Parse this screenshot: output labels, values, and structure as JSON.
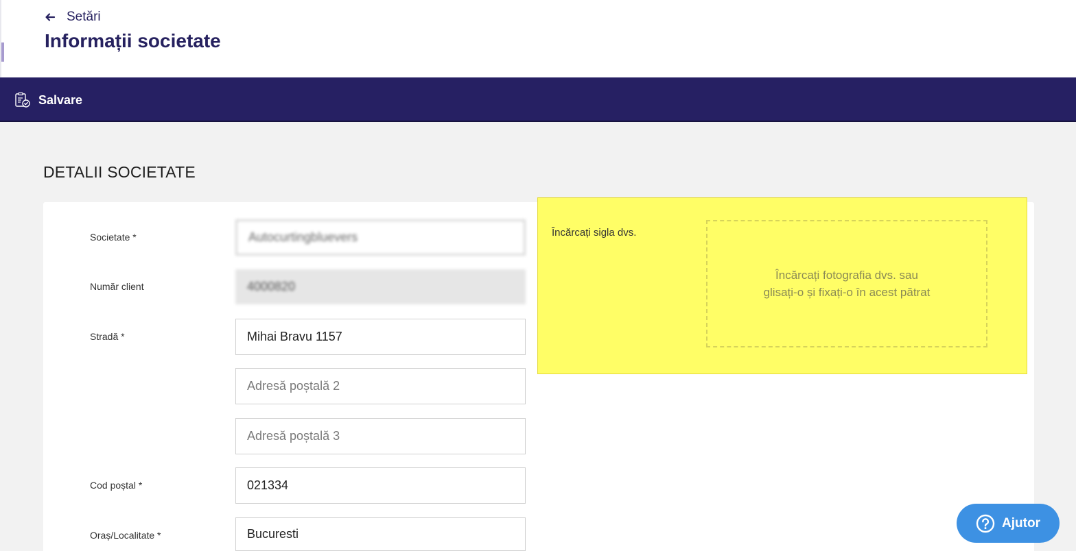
{
  "header": {
    "back_label": "Setări",
    "title": "Informații societate"
  },
  "toolbar": {
    "save_label": "Salvare"
  },
  "section": {
    "heading": "DETALII SOCIETATE"
  },
  "form": {
    "company_label": "Societate *",
    "company_value": "Autocurtingbluevers",
    "client_number_label": "Număr client",
    "client_number_value": "4000820",
    "street_label": "Stradă *",
    "street_value": "Mihai Bravu 1157",
    "address2_placeholder": "Adresă poștală 2",
    "address3_placeholder": "Adresă poștală 3",
    "postal_code_label": "Cod poștal *",
    "postal_code_value": "021334",
    "city_label": "Oraș/Localitate *",
    "city_value": "Bucuresti"
  },
  "upload": {
    "label": "Încărcați sigla dvs.",
    "drop_line1": "Încărcați fotografia dvs. sau",
    "drop_line2": "glisați-o și fixați-o în acest pătrat",
    "highlight_color": "#fffe66"
  },
  "help": {
    "label": "Ajutor"
  },
  "colors": {
    "brand": "#262063",
    "help_button": "#3d91e3"
  }
}
